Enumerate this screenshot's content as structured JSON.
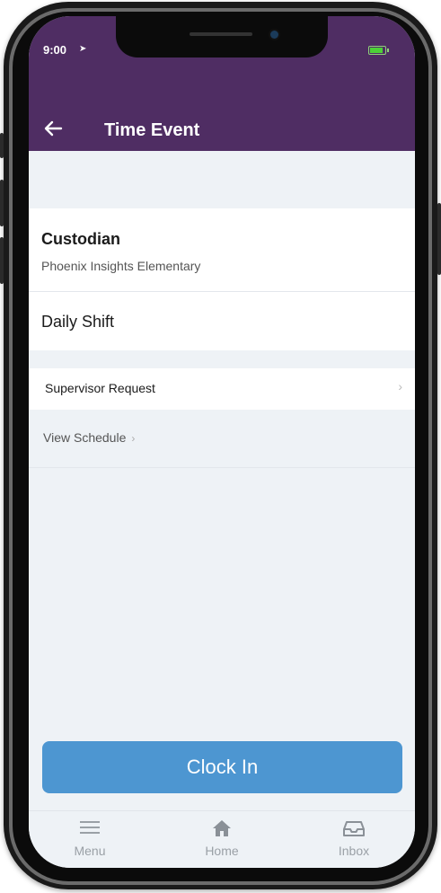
{
  "status_bar": {
    "time": "9:00"
  },
  "header": {
    "title": "Time Event"
  },
  "job": {
    "title": "Custodian",
    "location": "Phoenix Insights Elementary",
    "shift": "Daily Shift"
  },
  "supervisor_request": {
    "label": "Supervisor Request"
  },
  "view_schedule": {
    "label": "View Schedule"
  },
  "clock_in": {
    "label": "Clock In"
  },
  "tabbar": {
    "items": [
      {
        "label": "Menu",
        "icon": "menu-icon"
      },
      {
        "label": "Home",
        "icon": "home-icon"
      },
      {
        "label": "Inbox",
        "icon": "inbox-icon"
      }
    ]
  },
  "colors": {
    "header": "#4f2d63",
    "accent": "#4d96d1",
    "background": "#eef2f6"
  }
}
